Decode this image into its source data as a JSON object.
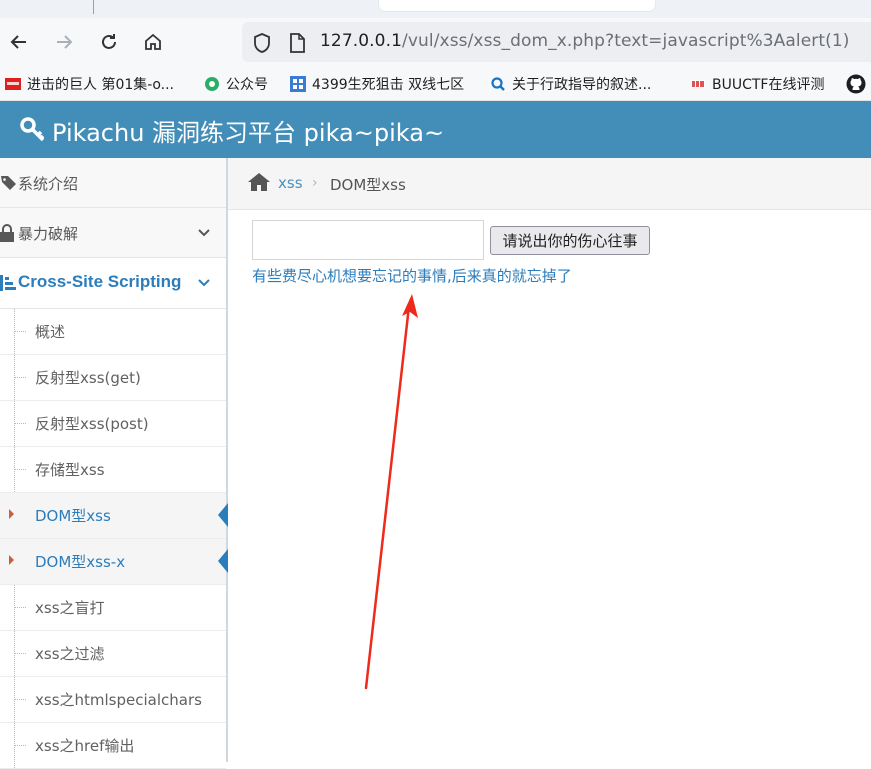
{
  "browser": {
    "url_host": "127.0.0.1",
    "url_path": "/vul/xss/xss_dom_x.php?text=javascript%3Aalert(1)",
    "bookmarks": [
      {
        "label": "进击的巨人 第01集-o...",
        "icon": "red-video-favicon"
      },
      {
        "label": "公众号",
        "icon": "wechat-favicon"
      },
      {
        "label": "4399生死狙击 双线七区",
        "icon": "blue-grid-favicon"
      },
      {
        "label": "关于行政指导的叙述...",
        "icon": "search-favicon"
      },
      {
        "label": "BUUCTF在线评测",
        "icon": "buuctf-favicon"
      }
    ]
  },
  "header": {
    "title": "Pikachu 漏洞练习平台 pika~pika~",
    "icon": "key-icon"
  },
  "sidebar": {
    "top_items": [
      {
        "label": "系统介绍",
        "icon": "tags-icon"
      },
      {
        "label": "暴力破解",
        "icon": "lock-icon"
      }
    ],
    "xss_section": {
      "label": "Cross-Site Scripting",
      "icon": "list-icon"
    },
    "sub_items": [
      {
        "label": "概述",
        "active": false
      },
      {
        "label": "反射型xss(get)",
        "active": false
      },
      {
        "label": "反射型xss(post)",
        "active": false
      },
      {
        "label": "存储型xss",
        "active": false
      },
      {
        "label": "DOM型xss",
        "active": true
      },
      {
        "label": "DOM型xss-x",
        "active": true
      },
      {
        "label": "xss之盲打",
        "active": false
      },
      {
        "label": "xss之过滤",
        "active": false
      },
      {
        "label": "xss之htmlspecialchars",
        "active": false
      },
      {
        "label": "xss之href输出",
        "active": false
      }
    ]
  },
  "breadcrumb": {
    "home_label": "xss",
    "current": "DOM型xss"
  },
  "form": {
    "input_value": "",
    "button_label": "请说出你的伤心往事",
    "output_link": "有些费尽心机想要忘记的事情,后来真的就忘掉了"
  },
  "colors": {
    "header_bg": "#438eb9",
    "accent": "#2b7dbc",
    "annotation_arrow": "#ee2a1a"
  }
}
